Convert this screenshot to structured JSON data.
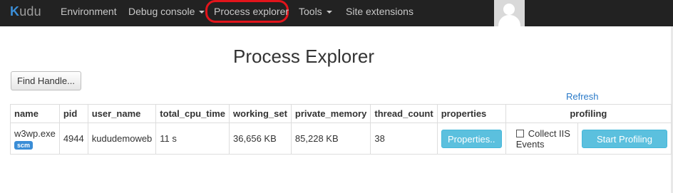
{
  "navbar": {
    "brand_k": "K",
    "brand_rest": "udu",
    "items": [
      {
        "label": "Environment"
      },
      {
        "label": "Debug console"
      },
      {
        "label": "Process explorer"
      },
      {
        "label": "Tools"
      },
      {
        "label": "Site extensions"
      }
    ]
  },
  "page": {
    "title": "Process Explorer",
    "find_handle_label": "Find Handle...",
    "refresh_label": "Refresh"
  },
  "table": {
    "headers": [
      "name",
      "pid",
      "user_name",
      "total_cpu_time",
      "working_set",
      "private_memory",
      "thread_count",
      "properties",
      "profiling"
    ],
    "rows": [
      {
        "name": "w3wp.exe",
        "badge": "scm",
        "pid": "4944",
        "user_name": "kududemoweb",
        "total_cpu_time": "11 s",
        "working_set": "36,656 KB",
        "private_memory": "85,228 KB",
        "thread_count": "38",
        "properties_button": "Properties..",
        "collect_iis_label": "Collect IIS Events",
        "collect_iis_checked": false,
        "profiling_button": "Start Profiling"
      }
    ]
  },
  "colors": {
    "navbar_bg": "#222222",
    "highlight": "#e2141b",
    "info_button": "#5bc0de",
    "link": "#2a7ac8",
    "badge": "#3a8dd6"
  }
}
